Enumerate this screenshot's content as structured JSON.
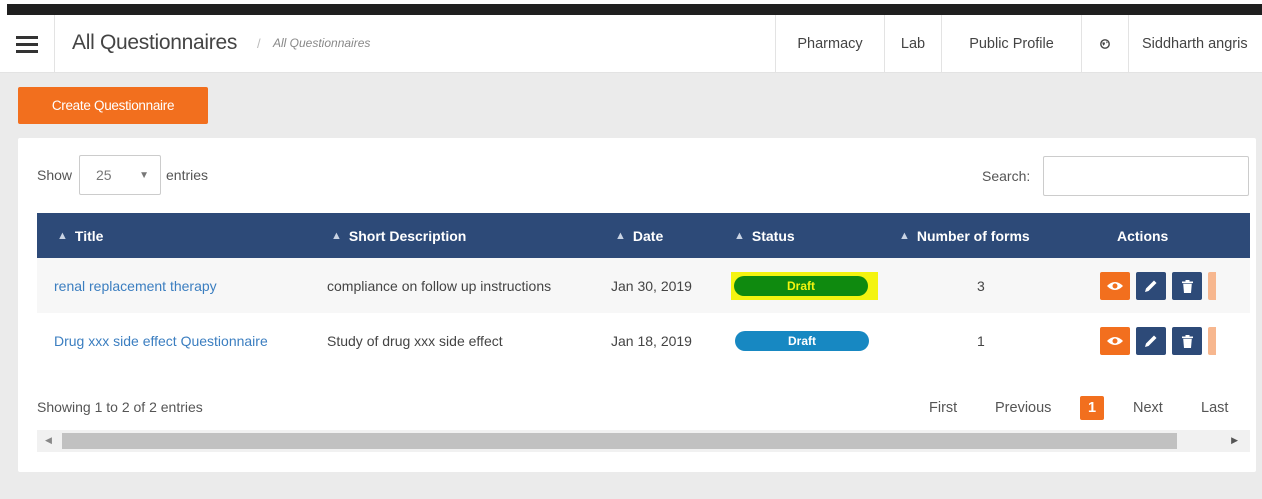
{
  "header": {
    "title": "All Questionnaires",
    "breadcrumb_sep": "/",
    "breadcrumb": "All Questionnaires",
    "nav": [
      "Pharmacy",
      "Lab",
      "Public Profile"
    ],
    "globe_icon": "globe-icon",
    "user": "Siddharth angris"
  },
  "toolbar": {
    "create_label": "Create Questionnaire"
  },
  "table_controls": {
    "show_label": "Show",
    "entries_value": "25",
    "entries_label": "entries",
    "search_label": "Search:",
    "search_value": ""
  },
  "table": {
    "columns": [
      "Title",
      "Short Description",
      "Date",
      "Status",
      "Number of forms",
      "Actions"
    ],
    "rows": [
      {
        "title": "renal replacement therapy",
        "description": "compliance on follow up instructions",
        "date": "Jan 30, 2019",
        "status": "Draft",
        "status_color": "#0f8a0f",
        "forms": "3"
      },
      {
        "title": "Drug xxx side effect Questionnaire",
        "description": "Study of drug xxx side effect",
        "date": "Jan 18, 2019",
        "status": "Draft",
        "status_color": "#1788c2",
        "forms": "1"
      }
    ],
    "action_icons": [
      "eye-icon",
      "pencil-icon",
      "trash-icon"
    ]
  },
  "footer": {
    "info": "Showing 1 to 2 of 2 entries",
    "pager": {
      "first": "First",
      "previous": "Previous",
      "current": "1",
      "next": "Next",
      "last": "Last"
    }
  },
  "colors": {
    "accent": "#f26f1e",
    "table_header": "#2d4a78",
    "link": "#3b7ec0",
    "highlight": "#f4f410"
  }
}
